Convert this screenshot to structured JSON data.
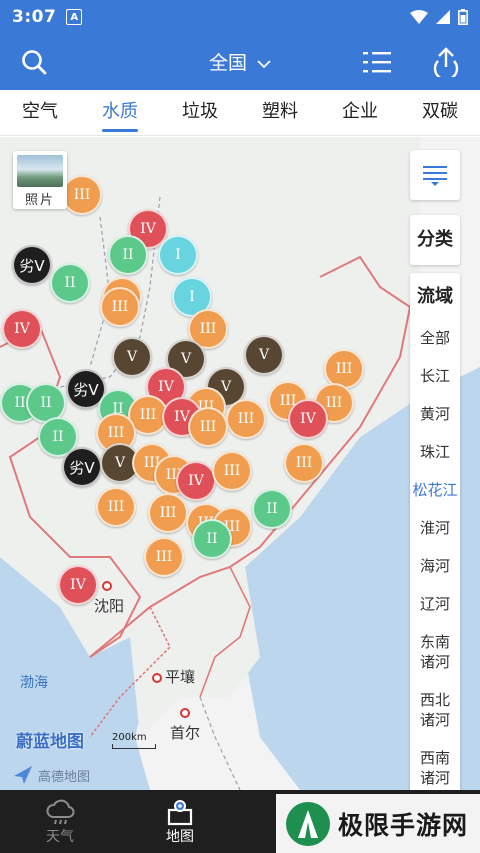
{
  "status_bar": {
    "time": "3:07",
    "notification_letter": "A"
  },
  "app_bar": {
    "region": "全国",
    "icons": [
      "search-icon",
      "chevron-down-icon",
      "list-icon",
      "share-icon"
    ]
  },
  "tabs": [
    {
      "label": "空气",
      "active": false
    },
    {
      "label": "水质",
      "active": true
    },
    {
      "label": "垃圾",
      "active": false
    },
    {
      "label": "塑料",
      "active": false
    },
    {
      "label": "企业",
      "active": false
    },
    {
      "label": "双碳",
      "active": false
    }
  ],
  "map": {
    "photo_label": "照片",
    "classify_label": "分类",
    "basin_label": "流域",
    "basins": [
      "全部",
      "长江",
      "黄河",
      "珠江",
      "松花江",
      "淮河",
      "海河",
      "辽河",
      "东南诸河",
      "西北诸河",
      "西南诸河"
    ],
    "active_basin": "松花江",
    "places": {
      "shenyang": "沈阳",
      "pyongyang": "平壤",
      "seoul": "首尔",
      "bohai": "渤海"
    },
    "brand": "蔚蓝地图",
    "scale": "200km",
    "provider": "高德地图",
    "markers": [
      {
        "grade": "III",
        "cls": "III",
        "label": "III"
      },
      {
        "grade": "IV",
        "cls": "IV",
        "label": "IV"
      },
      {
        "grade": "I",
        "cls": "I",
        "label": "I"
      },
      {
        "grade": "II",
        "cls": "II",
        "label": "II"
      },
      {
        "grade": "劣V",
        "cls": "bad",
        "label": "劣V"
      },
      {
        "grade": "II",
        "cls": "II",
        "label": "II"
      },
      {
        "grade": "III",
        "cls": "III",
        "label": "III"
      },
      {
        "grade": "I",
        "cls": "I",
        "label": "I"
      },
      {
        "grade": "IV",
        "cls": "IV",
        "label": "IV"
      },
      {
        "grade": "III",
        "cls": "III",
        "label": "III"
      },
      {
        "grade": "III",
        "cls": "III",
        "label": "III"
      },
      {
        "grade": "V",
        "cls": "V",
        "label": "V"
      },
      {
        "grade": "V",
        "cls": "V",
        "label": "V"
      },
      {
        "grade": "V",
        "cls": "V",
        "label": "V"
      },
      {
        "grade": "III",
        "cls": "III",
        "label": "III"
      },
      {
        "grade": "劣V",
        "cls": "bad",
        "label": "劣V"
      },
      {
        "grade": "II",
        "cls": "II",
        "label": "II"
      },
      {
        "grade": "II",
        "cls": "II",
        "label": "II"
      },
      {
        "grade": "IV",
        "cls": "IV",
        "label": "IV"
      },
      {
        "grade": "V",
        "cls": "V",
        "label": "V"
      },
      {
        "grade": "III",
        "cls": "III",
        "label": "III"
      },
      {
        "grade": "II",
        "cls": "II",
        "label": "II"
      },
      {
        "grade": "III",
        "cls": "III",
        "label": "III"
      },
      {
        "grade": "IV",
        "cls": "IV",
        "label": "IV"
      },
      {
        "grade": "III",
        "cls": "III",
        "label": "III"
      },
      {
        "grade": "III",
        "cls": "III",
        "label": "III"
      },
      {
        "grade": "III",
        "cls": "III",
        "label": "III"
      },
      {
        "grade": "IV",
        "cls": "IV",
        "label": "IV"
      },
      {
        "grade": "III",
        "cls": "III",
        "label": "III"
      },
      {
        "grade": "III",
        "cls": "III",
        "label": "III"
      },
      {
        "grade": "II",
        "cls": "II",
        "label": "II"
      },
      {
        "grade": "劣V",
        "cls": "bad",
        "label": "劣V"
      },
      {
        "grade": "V",
        "cls": "V",
        "label": "V"
      },
      {
        "grade": "III",
        "cls": "III",
        "label": "III"
      },
      {
        "grade": "III",
        "cls": "III",
        "label": "III"
      },
      {
        "grade": "IV",
        "cls": "IV",
        "label": "IV"
      },
      {
        "grade": "III",
        "cls": "III",
        "label": "III"
      },
      {
        "grade": "III",
        "cls": "III",
        "label": "III"
      },
      {
        "grade": "III",
        "cls": "III",
        "label": "III"
      },
      {
        "grade": "II",
        "cls": "II",
        "label": "II"
      },
      {
        "grade": "III",
        "cls": "III",
        "label": "III"
      },
      {
        "grade": "III",
        "cls": "III",
        "label": "III"
      },
      {
        "grade": "III",
        "cls": "III",
        "label": "III"
      },
      {
        "grade": "II",
        "cls": "II",
        "label": "II"
      },
      {
        "grade": "III",
        "cls": "III",
        "label": "III"
      },
      {
        "grade": "IV",
        "cls": "IV",
        "label": "IV"
      }
    ]
  },
  "bottom_nav": [
    {
      "label": "天气",
      "icon": "weather-icon",
      "active": false
    },
    {
      "label": "地图",
      "icon": "map-pin-icon",
      "active": true
    },
    {
      "label": "",
      "icon": "",
      "active": false
    },
    {
      "label": "",
      "icon": "",
      "active": false
    }
  ],
  "watermark": {
    "text": "极限手游网"
  },
  "colors": {
    "primary": "#3b79d6",
    "grade_I": "#67d4df",
    "grade_II": "#5cc98a",
    "grade_III": "#f09d4f",
    "grade_IV": "#e05058",
    "grade_V": "#574732",
    "grade_bad": "#1e1e1e"
  }
}
